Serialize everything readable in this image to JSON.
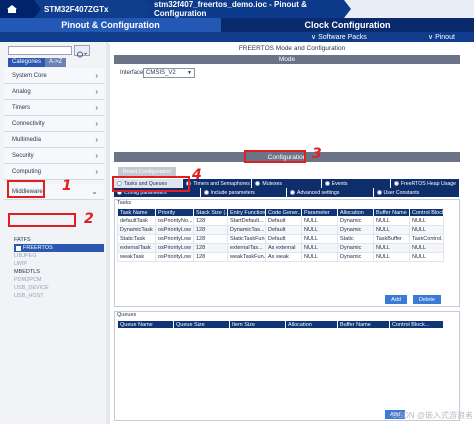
{
  "breadcrumb": {
    "items": [
      "STM32F407ZGTx",
      "stm32f407_freertos_demo.ioc - Pinout & Configuration"
    ]
  },
  "main_tabs": {
    "active": "Pinout & Configuration",
    "inactive": "Clock Configuration"
  },
  "sub_bar": {
    "software_packs": "∨ Software Packs",
    "pinout": "∨ Pinout"
  },
  "left_panel": {
    "tabs": [
      "Categories",
      "A->Z"
    ],
    "categories": [
      "System Core",
      "Analog",
      "Timers",
      "Connectivity",
      "Multimedia",
      "Security",
      "Computing",
      "Middleware"
    ],
    "middleware_items": [
      {
        "label": "FATFS",
        "state": "normal"
      },
      {
        "label": "FREERTOS",
        "state": "selected"
      },
      {
        "label": "LIBJPEG",
        "state": "disabled"
      },
      {
        "label": "LWIP",
        "state": "disabled"
      },
      {
        "label": "MBEDTLS",
        "state": "normal"
      },
      {
        "label": "PDM2PCM",
        "state": "disabled"
      },
      {
        "label": "USB_DEVICE",
        "state": "disabled"
      },
      {
        "label": "USB_HOST",
        "state": "disabled"
      }
    ]
  },
  "right_panel": {
    "title": "FREERTOS Mode and Configuration",
    "mode_header": "Mode",
    "interface_label": "Interface",
    "interface_value": "CMSIS_V2",
    "config_header": "Configuration",
    "reset_button": "Reset Configuration",
    "tabs_row1": [
      "Tasks and Queues",
      "Timers and Semaphores",
      "Mutexes",
      "Events",
      "FreeRTOS Heap Usage"
    ],
    "tabs_row2": [
      "Config parameters",
      "Include parameters",
      "Advanced settings",
      "User Constants"
    ],
    "active_tab": "Tasks and Queues",
    "tasks": {
      "label": "Tasks",
      "columns": [
        "Task Name",
        "Priority",
        "Stack Size (...",
        "Entry Function",
        "Code Gener...",
        "Parameter",
        "Allocation",
        "Buffer Name",
        "Control Block..."
      ],
      "rows": [
        [
          "defaultTask",
          "osPriorityNo...",
          "128",
          "StartDefault...",
          "Default",
          "NULL",
          "Dynamic",
          "NULL",
          "NULL"
        ],
        [
          "DynamicTask",
          "osPriorityLow",
          "128",
          "DynamicTas...",
          "Default",
          "NULL",
          "Dynamic",
          "NULL",
          "NULL"
        ],
        [
          "StaticTask",
          "osPriorityLow",
          "128",
          "StaticTaskFun...",
          "Default",
          "NULL",
          "Static",
          "TaskBuffer",
          "TaskControl..."
        ],
        [
          "externalTask",
          "osPriorityLow",
          "128",
          "externalTas...",
          "As external",
          "NULL",
          "Dynamic",
          "NULL",
          "NULL"
        ],
        [
          "weakTask",
          "osPriorityLow",
          "128",
          "weakTaskFun...",
          "As weak",
          "NULL",
          "Dynamic",
          "NULL",
          "NULL"
        ]
      ],
      "add_button": "Add",
      "delete_button": "Delete"
    },
    "queues": {
      "label": "Queues",
      "columns": [
        "Queue Name",
        "Queue Size",
        "Item Size",
        "Allocation",
        "Buffer Name",
        "Control Block..."
      ],
      "add_button": "Add"
    }
  },
  "annotations": [
    "1",
    "2",
    "3",
    "4"
  ],
  "watermark": "CSDN @嵌入式游浪者"
}
